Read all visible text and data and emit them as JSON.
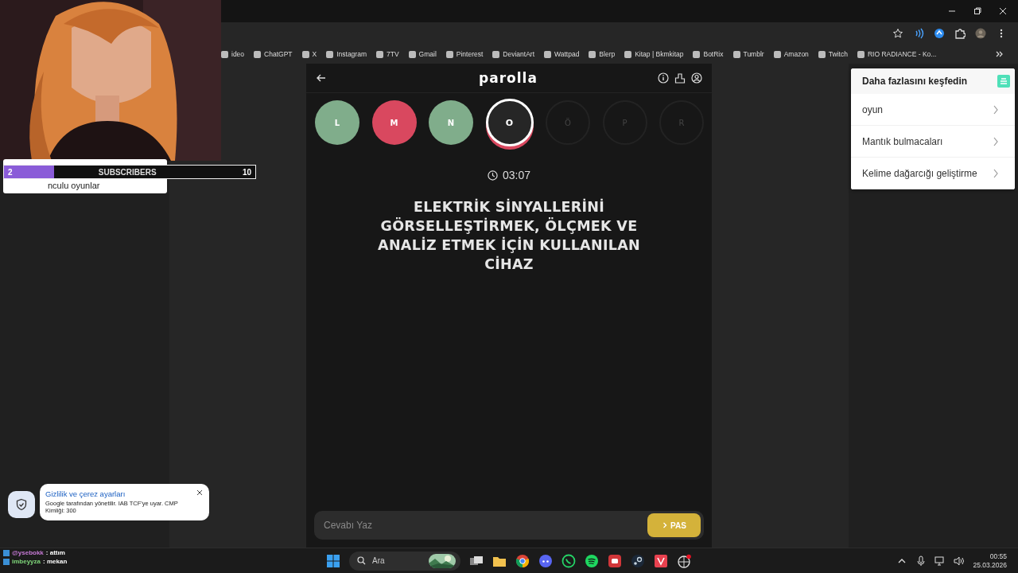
{
  "bookmarks": [
    {
      "label": "ideo"
    },
    {
      "label": "ChatGPT"
    },
    {
      "label": "X"
    },
    {
      "label": "Instagram"
    },
    {
      "label": "7TV"
    },
    {
      "label": "Gmail"
    },
    {
      "label": "Pinterest"
    },
    {
      "label": "DeviantArt"
    },
    {
      "label": "Wattpad"
    },
    {
      "label": "Blerp"
    },
    {
      "label": "Kitap | Bkmkitap"
    },
    {
      "label": "BotRix"
    },
    {
      "label": "Tumblr"
    },
    {
      "label": "Amazon"
    },
    {
      "label": "Twitch"
    },
    {
      "label": "RIO RADIANCE - Ko..."
    }
  ],
  "game": {
    "title": "parolla",
    "letters": [
      {
        "letter": "L",
        "kind": "correct"
      },
      {
        "letter": "M",
        "kind": "wrong"
      },
      {
        "letter": "N",
        "kind": "correct"
      },
      {
        "letter": "O",
        "kind": "current"
      },
      {
        "letter": "Ö",
        "kind": "pending"
      },
      {
        "letter": "P",
        "kind": "pending"
      },
      {
        "letter": "R",
        "kind": "pending"
      }
    ],
    "timer": "03:07",
    "question": "ELEKTRİK SİNYALLERİNİ GÖRSELLEŞTİRMEK, ÖLÇMEK VE ANALİZ ETMEK İÇİN KULLANILAN CİHAZ",
    "answer": {
      "placeholder": "Cevabı Yaz"
    },
    "pass_button": "PAS"
  },
  "side_card": {
    "title": "Daha fazlasını keşfedin",
    "items": [
      "oyun",
      "Mantık bulmacaları",
      "Kelime dağarcığı geliştirme"
    ]
  },
  "subscribers": {
    "current": "2",
    "label": "SUBSCRIBERS",
    "goal": "10",
    "level": 0.2
  },
  "hidden_card_text": "nculu oyunlar",
  "cookie_toast": {
    "title": "Gizlilik ve çerez ayarları",
    "body": "Google tarafından yönetilir. IAB TCF'ye uyar. CMP Kimliği: 300"
  },
  "chat": [
    {
      "user": "@ysebokk",
      "message": ": attım"
    },
    {
      "user": "imbeyyza",
      "message": ": mekan"
    }
  ],
  "taskbar": {
    "search_placeholder": "Ara",
    "time": "00:55",
    "date": "25.03.2026"
  }
}
